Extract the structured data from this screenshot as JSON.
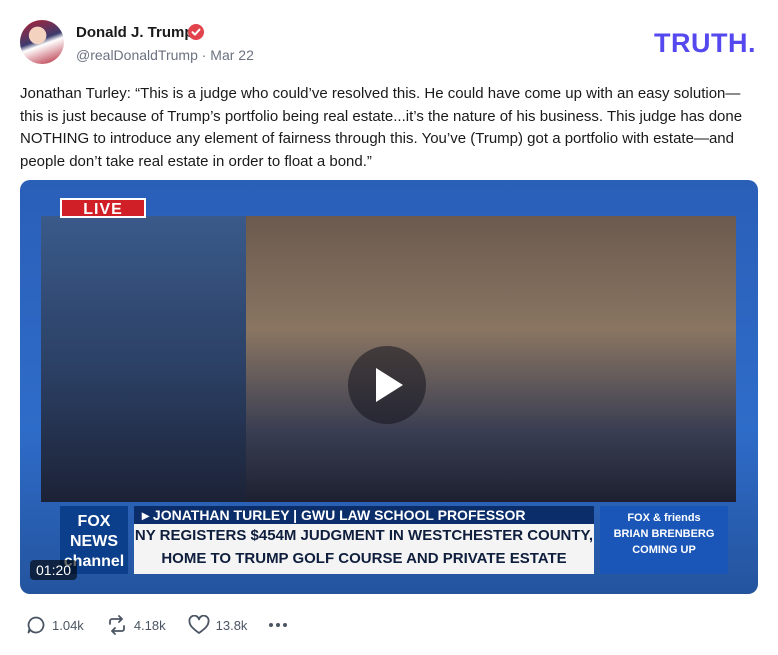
{
  "post": {
    "author_name": "Donald J. Trump",
    "handle_date": "@realDonaldTrump · Mar 22",
    "logo": "TRUTH.",
    "text": "Jonathan Turley: “This is a judge who could’ve resolved this. He could have come up with an easy solution—this is just because of Trump’s portfolio being real estate...it’s the nature of his business. This judge has done NOTHING to introduce any element of fairness through this. You’ve (Trump) got a portfolio with estate—and people don’t take real estate in order to float a bond.”"
  },
  "video": {
    "live_label": "LIVE",
    "network_logo": "FOX NEWS channel",
    "name_bar": "▸ JONATHAN TURLEY | GWU LAW SCHOOL PROFESSOR",
    "headline": "NY REGISTERS $454M JUDGMENT IN WESTCHESTER COUNTY, HOME TO TRUMP GOLF COURSE AND PRIVATE ESTATE",
    "promo_show": "FOX & friends",
    "promo_host": "BRIAN BRENBERG",
    "promo_status": "COMING UP",
    "duration": "01:20"
  },
  "actions": {
    "replies": "1.04k",
    "retruths": "4.18k",
    "likes": "13.8k"
  },
  "colors": {
    "brand": "#5448ee",
    "verified": "#e2434c",
    "text": "#1a1a1a",
    "muted": "#6b7280"
  },
  "icons": [
    "verified-badge-icon",
    "play-icon",
    "reply-icon",
    "retruth-icon",
    "like-icon",
    "more-icon"
  ]
}
